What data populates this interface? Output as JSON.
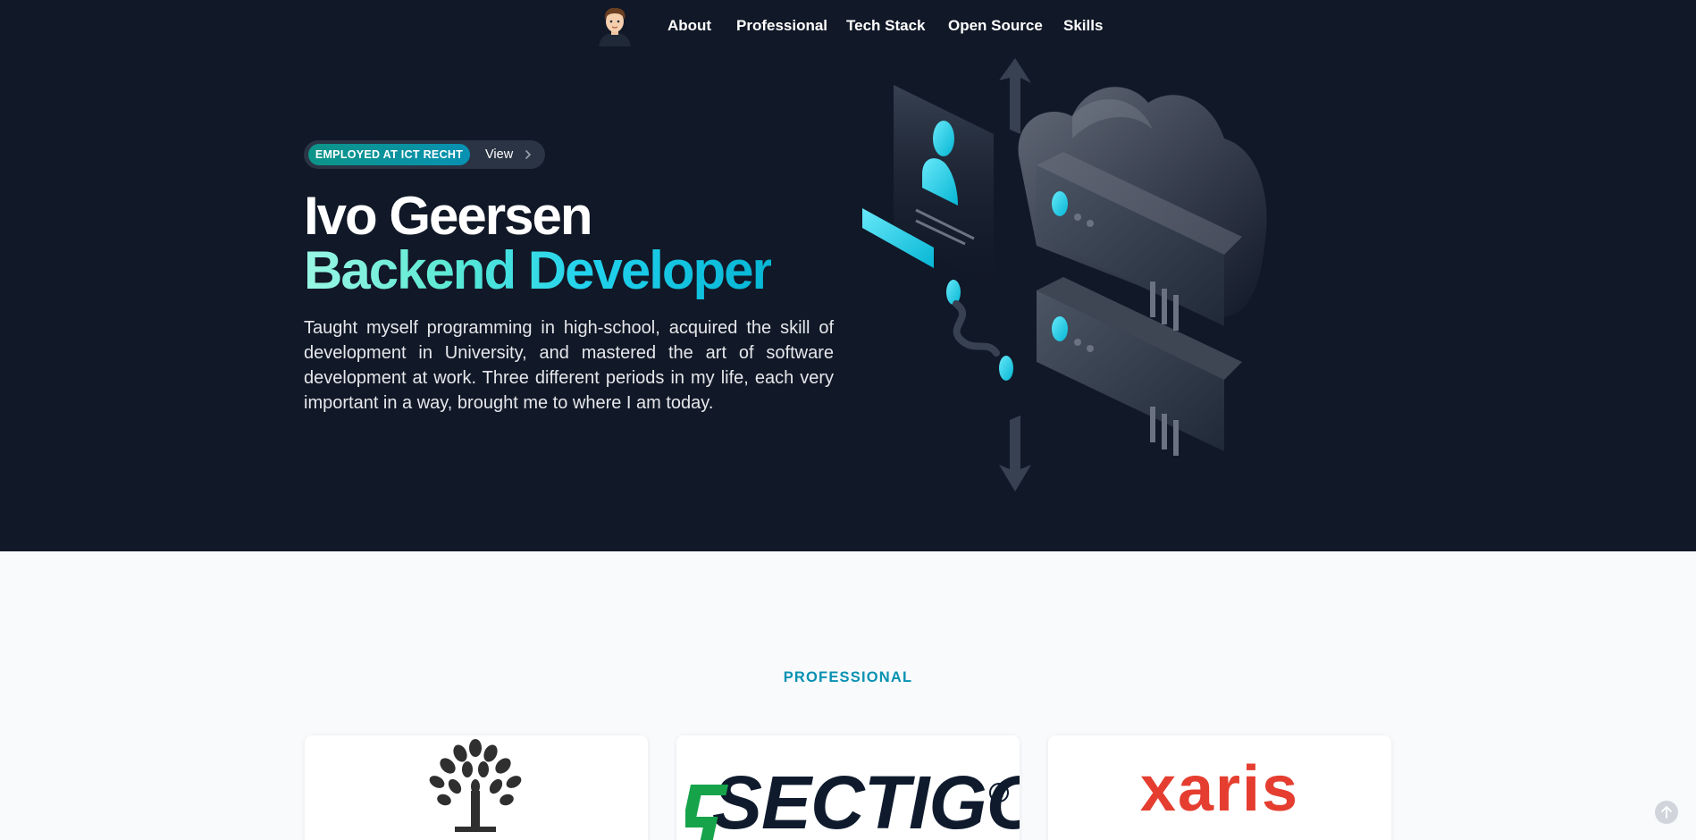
{
  "nav": {
    "items": [
      {
        "label": "About"
      },
      {
        "label": "Professional"
      },
      {
        "label": "Tech Stack"
      },
      {
        "label": "Open Source"
      },
      {
        "label": "Skills"
      }
    ]
  },
  "hero": {
    "badge": "EMPLOYED AT ICT RECHT",
    "badge_link": "View",
    "name": "Ivo Geersen",
    "role": "Backend Developer",
    "intro": "Taught myself programming in high-school, acquired the skill of development in University, and mastered the art of software development at work. Three different periods in my life, each very important in a way, brought me to where I am today."
  },
  "professional": {
    "heading": "PROFESSIONAL",
    "companies": [
      {
        "logo_icon": "tree-icon"
      },
      {
        "logo_text": "SECTIGO",
        "registered_mark": "R"
      },
      {
        "logo_text": "xaris"
      }
    ]
  },
  "colors": {
    "hero_bg": "#111827",
    "accent_teal": "#0d9488",
    "accent_cyan": "#22d3ee",
    "section_label": "#0891b2",
    "sectigo_green": "#16a34a",
    "xaris_red": "#e53e30"
  }
}
